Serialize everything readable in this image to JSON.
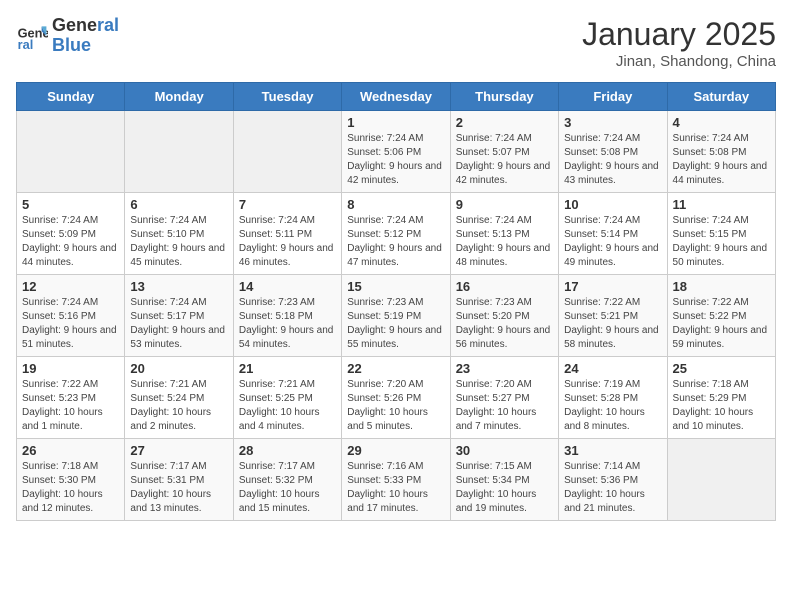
{
  "logo": {
    "line1": "General",
    "line2": "Blue"
  },
  "title": "January 2025",
  "subtitle": "Jinan, Shandong, China",
  "days_of_week": [
    "Sunday",
    "Monday",
    "Tuesday",
    "Wednesday",
    "Thursday",
    "Friday",
    "Saturday"
  ],
  "weeks": [
    [
      {
        "day": "",
        "info": ""
      },
      {
        "day": "",
        "info": ""
      },
      {
        "day": "",
        "info": ""
      },
      {
        "day": "1",
        "info": "Sunrise: 7:24 AM\nSunset: 5:06 PM\nDaylight: 9 hours and 42 minutes."
      },
      {
        "day": "2",
        "info": "Sunrise: 7:24 AM\nSunset: 5:07 PM\nDaylight: 9 hours and 42 minutes."
      },
      {
        "day": "3",
        "info": "Sunrise: 7:24 AM\nSunset: 5:08 PM\nDaylight: 9 hours and 43 minutes."
      },
      {
        "day": "4",
        "info": "Sunrise: 7:24 AM\nSunset: 5:08 PM\nDaylight: 9 hours and 44 minutes."
      }
    ],
    [
      {
        "day": "5",
        "info": "Sunrise: 7:24 AM\nSunset: 5:09 PM\nDaylight: 9 hours and 44 minutes."
      },
      {
        "day": "6",
        "info": "Sunrise: 7:24 AM\nSunset: 5:10 PM\nDaylight: 9 hours and 45 minutes."
      },
      {
        "day": "7",
        "info": "Sunrise: 7:24 AM\nSunset: 5:11 PM\nDaylight: 9 hours and 46 minutes."
      },
      {
        "day": "8",
        "info": "Sunrise: 7:24 AM\nSunset: 5:12 PM\nDaylight: 9 hours and 47 minutes."
      },
      {
        "day": "9",
        "info": "Sunrise: 7:24 AM\nSunset: 5:13 PM\nDaylight: 9 hours and 48 minutes."
      },
      {
        "day": "10",
        "info": "Sunrise: 7:24 AM\nSunset: 5:14 PM\nDaylight: 9 hours and 49 minutes."
      },
      {
        "day": "11",
        "info": "Sunrise: 7:24 AM\nSunset: 5:15 PM\nDaylight: 9 hours and 50 minutes."
      }
    ],
    [
      {
        "day": "12",
        "info": "Sunrise: 7:24 AM\nSunset: 5:16 PM\nDaylight: 9 hours and 51 minutes."
      },
      {
        "day": "13",
        "info": "Sunrise: 7:24 AM\nSunset: 5:17 PM\nDaylight: 9 hours and 53 minutes."
      },
      {
        "day": "14",
        "info": "Sunrise: 7:23 AM\nSunset: 5:18 PM\nDaylight: 9 hours and 54 minutes."
      },
      {
        "day": "15",
        "info": "Sunrise: 7:23 AM\nSunset: 5:19 PM\nDaylight: 9 hours and 55 minutes."
      },
      {
        "day": "16",
        "info": "Sunrise: 7:23 AM\nSunset: 5:20 PM\nDaylight: 9 hours and 56 minutes."
      },
      {
        "day": "17",
        "info": "Sunrise: 7:22 AM\nSunset: 5:21 PM\nDaylight: 9 hours and 58 minutes."
      },
      {
        "day": "18",
        "info": "Sunrise: 7:22 AM\nSunset: 5:22 PM\nDaylight: 9 hours and 59 minutes."
      }
    ],
    [
      {
        "day": "19",
        "info": "Sunrise: 7:22 AM\nSunset: 5:23 PM\nDaylight: 10 hours and 1 minute."
      },
      {
        "day": "20",
        "info": "Sunrise: 7:21 AM\nSunset: 5:24 PM\nDaylight: 10 hours and 2 minutes."
      },
      {
        "day": "21",
        "info": "Sunrise: 7:21 AM\nSunset: 5:25 PM\nDaylight: 10 hours and 4 minutes."
      },
      {
        "day": "22",
        "info": "Sunrise: 7:20 AM\nSunset: 5:26 PM\nDaylight: 10 hours and 5 minutes."
      },
      {
        "day": "23",
        "info": "Sunrise: 7:20 AM\nSunset: 5:27 PM\nDaylight: 10 hours and 7 minutes."
      },
      {
        "day": "24",
        "info": "Sunrise: 7:19 AM\nSunset: 5:28 PM\nDaylight: 10 hours and 8 minutes."
      },
      {
        "day": "25",
        "info": "Sunrise: 7:18 AM\nSunset: 5:29 PM\nDaylight: 10 hours and 10 minutes."
      }
    ],
    [
      {
        "day": "26",
        "info": "Sunrise: 7:18 AM\nSunset: 5:30 PM\nDaylight: 10 hours and 12 minutes."
      },
      {
        "day": "27",
        "info": "Sunrise: 7:17 AM\nSunset: 5:31 PM\nDaylight: 10 hours and 13 minutes."
      },
      {
        "day": "28",
        "info": "Sunrise: 7:17 AM\nSunset: 5:32 PM\nDaylight: 10 hours and 15 minutes."
      },
      {
        "day": "29",
        "info": "Sunrise: 7:16 AM\nSunset: 5:33 PM\nDaylight: 10 hours and 17 minutes."
      },
      {
        "day": "30",
        "info": "Sunrise: 7:15 AM\nSunset: 5:34 PM\nDaylight: 10 hours and 19 minutes."
      },
      {
        "day": "31",
        "info": "Sunrise: 7:14 AM\nSunset: 5:36 PM\nDaylight: 10 hours and 21 minutes."
      },
      {
        "day": "",
        "info": ""
      }
    ]
  ]
}
